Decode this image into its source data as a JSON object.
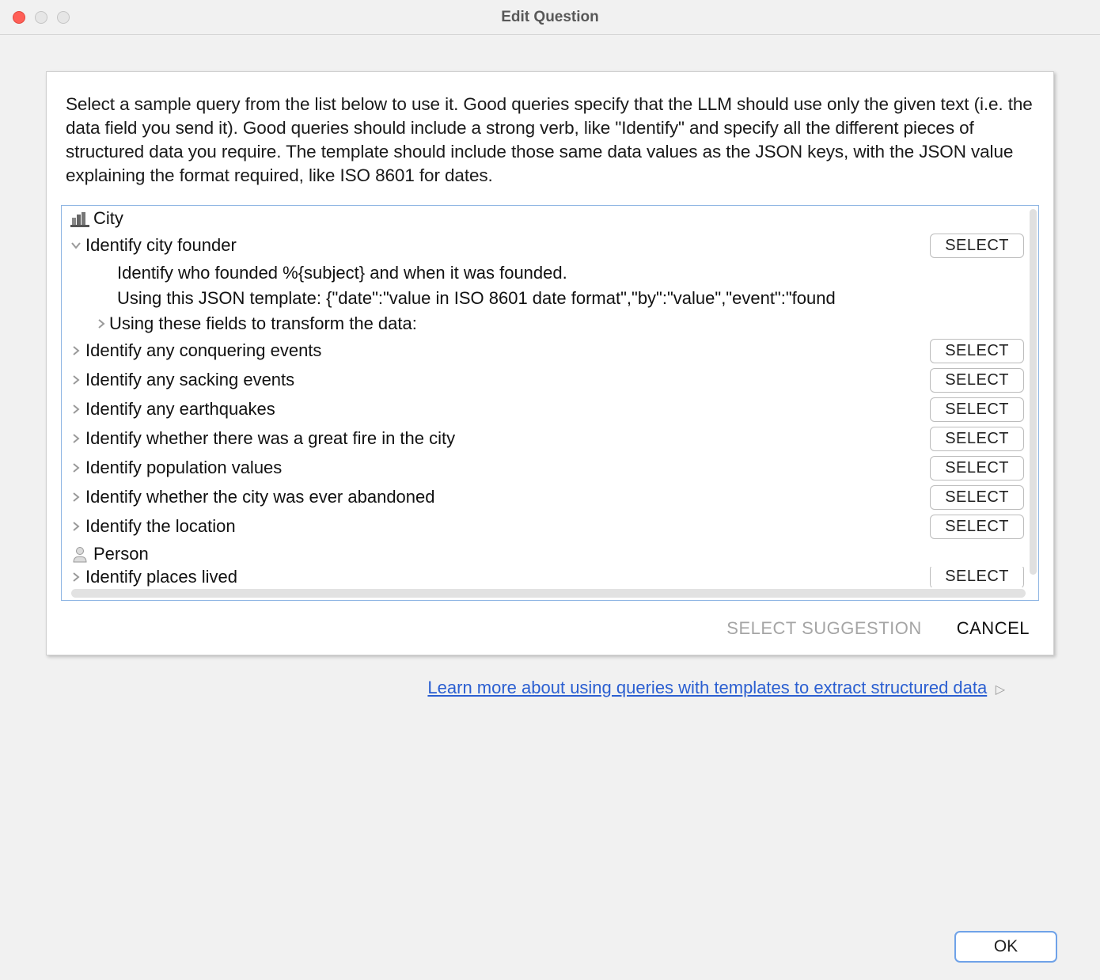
{
  "window": {
    "title": "Edit Question"
  },
  "instructions": "Select a sample query from the list below to use it. Good queries specify that the LLM should use only the given text (i.e. the data field you send it). Good queries should include a strong verb, like \"Identify\" and specify all the different pieces of structured data you require. The template should include those same data values as the JSON keys, with the JSON value explaining the format required, like ISO 8601 for dates.",
  "groups": [
    {
      "name": "City",
      "icon": "city-icon",
      "queries": [
        {
          "label": "Identify city founder",
          "expanded": true,
          "detail1": "Identify who founded %{subject} and when it was founded.",
          "detail2": "Using this JSON template: {\"date\":\"value in ISO 8601 date format\",\"by\":\"value\",\"event\":\"found",
          "sub": "Using these fields to transform the data:",
          "select": "SELECT"
        },
        {
          "label": "Identify any conquering events",
          "expanded": false,
          "select": "SELECT"
        },
        {
          "label": "Identify any sacking events",
          "expanded": false,
          "select": "SELECT"
        },
        {
          "label": "Identify any earthquakes",
          "expanded": false,
          "select": "SELECT"
        },
        {
          "label": "Identify whether there was a great fire in the city",
          "expanded": false,
          "select": "SELECT"
        },
        {
          "label": "Identify population values",
          "expanded": false,
          "select": "SELECT"
        },
        {
          "label": "Identify whether the city was ever abandoned",
          "expanded": false,
          "select": "SELECT"
        },
        {
          "label": "Identify the location",
          "expanded": false,
          "select": "SELECT"
        }
      ]
    },
    {
      "name": "Person",
      "icon": "person-icon",
      "queries": [
        {
          "label": "Identify places lived",
          "expanded": false,
          "select": "SELECT"
        }
      ]
    }
  ],
  "dialogButtons": {
    "selectSuggestion": "SELECT SUGGESTION",
    "cancel": "CANCEL"
  },
  "learnMore": "Learn more about using queries with templates to extract structured data",
  "ok": "OK"
}
